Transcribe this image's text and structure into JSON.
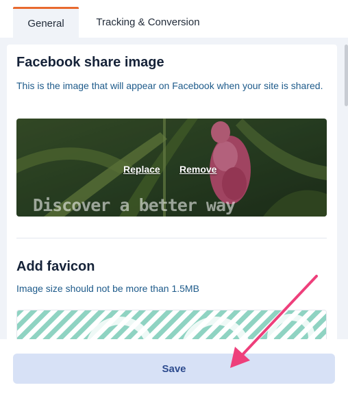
{
  "tabs": [
    {
      "label": "General",
      "active": true
    },
    {
      "label": "Tracking & Conversion",
      "active": false
    }
  ],
  "facebook_share": {
    "title": "Facebook share image",
    "description": "This is the image that will appear on Facebook when your site is shared.",
    "replace_label": "Replace",
    "remove_label": "Remove",
    "image_caption": "Discover a better way"
  },
  "favicon": {
    "title": "Add favicon",
    "description": "Image size should not be more than 1.5MB"
  },
  "footer": {
    "save_label": "Save"
  },
  "colors": {
    "tab_accent": "#e8692e",
    "text_blue": "#1d5a8a",
    "save_bg": "#d7e1f6",
    "arrow": "#ee3f7b"
  },
  "icons": {
    "annotation": "arrow-icon"
  }
}
